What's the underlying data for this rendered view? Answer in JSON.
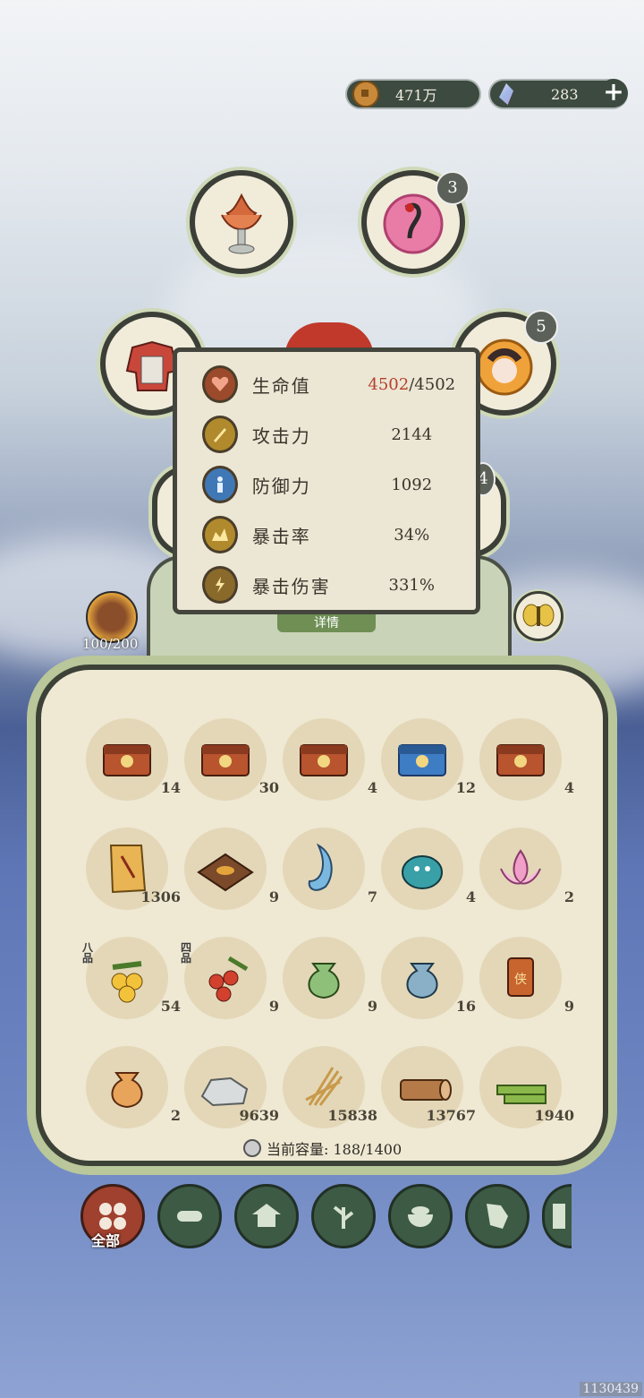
{
  "currency": {
    "coins": "471万",
    "gems": "283",
    "add_label": "+"
  },
  "equipment": {
    "badges": [
      "3",
      "5",
      "4"
    ]
  },
  "stats": {
    "rows": [
      {
        "label": "生命值",
        "current": "4502",
        "max": "/4502"
      },
      {
        "label": "攻击力",
        "value": "2144"
      },
      {
        "label": "防御力",
        "value": "1092"
      },
      {
        "label": "暴击率",
        "value": "34%"
      },
      {
        "label": "暴击伤害",
        "value": "331%"
      }
    ]
  },
  "stamina": "100/200",
  "detail_button": "详情",
  "bag": {
    "items": [
      {
        "icon": "treasure-chest-icon",
        "count": "14"
      },
      {
        "icon": "treasure-chest-icon",
        "count": "30"
      },
      {
        "icon": "treasure-chest-icon",
        "count": "4"
      },
      {
        "icon": "treasure-chest-blue-icon",
        "count": "12"
      },
      {
        "icon": "treasure-chest-icon",
        "count": "4"
      },
      {
        "icon": "scroll-icon",
        "count": "1306"
      },
      {
        "icon": "tray-icon",
        "count": "9"
      },
      {
        "icon": "spirit-fish-icon",
        "count": "7"
      },
      {
        "icon": "spirit-beast-icon",
        "count": "4"
      },
      {
        "icon": "lotus-icon",
        "count": "2"
      },
      {
        "icon": "yellow-berries-icon",
        "count": "54",
        "grade": "八品"
      },
      {
        "icon": "red-berries-icon",
        "count": "9",
        "grade": "四品"
      },
      {
        "icon": "green-pouch-icon",
        "count": "9"
      },
      {
        "icon": "blue-pouch-icon",
        "count": "16"
      },
      {
        "icon": "token-icon",
        "count": "9"
      },
      {
        "icon": "orange-pouch-icon",
        "count": "2"
      },
      {
        "icon": "stone-icon",
        "count": "9639"
      },
      {
        "icon": "straw-icon",
        "count": "15838"
      },
      {
        "icon": "wood-log-icon",
        "count": "13767"
      },
      {
        "icon": "bamboo-icon",
        "count": "1940"
      }
    ],
    "capacity_label": "当前容量: 188/1400"
  },
  "tabs": {
    "all_label": "全部"
  },
  "watermark": "1130439"
}
